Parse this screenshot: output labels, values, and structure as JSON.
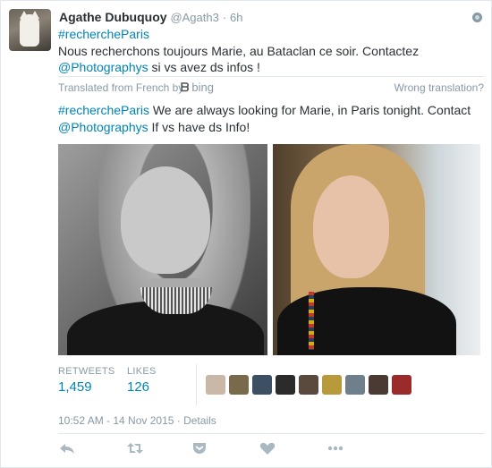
{
  "tweet": {
    "fullname": "Agathe Dubuquoy",
    "screen_name": "@Agath3",
    "separator": "·",
    "time": "6h",
    "text_hashtag": "#rechercheParis",
    "text_line1": "Nous recherchons toujours Marie, au Bataclan ce soir. Contactez",
    "text_mention": "@Photographys",
    "text_line2": " si vs avez ds infos !"
  },
  "translation": {
    "from_label": "Translated from French by",
    "provider": "bing",
    "wrong_label": "Wrong translation?",
    "hashtag": "#rechercheParis",
    "line1": " We are always looking for Marie, in Paris tonight. Contact",
    "mention": "@Photographys",
    "line2": " If vs have ds Info!"
  },
  "stats": {
    "retweets_label": "RETWEETS",
    "retweets_value": "1,459",
    "likes_label": "LIKES",
    "likes_value": "126"
  },
  "likers": [
    {
      "color": "#c9b8a8"
    },
    {
      "color": "#7a6a4c"
    },
    {
      "color": "#3c4f63"
    },
    {
      "color": "#2b2b2b"
    },
    {
      "color": "#5a4a3e"
    },
    {
      "color": "#b89a3a"
    },
    {
      "color": "#6f7f8c"
    },
    {
      "color": "#4a3a33"
    },
    {
      "color": "#9b2a2a"
    }
  ],
  "footer": {
    "timestamp": "10:52 AM - 14 Nov 2015",
    "sep": " · ",
    "details": "Details"
  },
  "icons": {
    "globe": "globe-icon",
    "reply": "reply-icon",
    "retweet": "retweet-icon",
    "pocket": "pocket-icon",
    "like": "heart-icon",
    "more": "more-icon"
  }
}
